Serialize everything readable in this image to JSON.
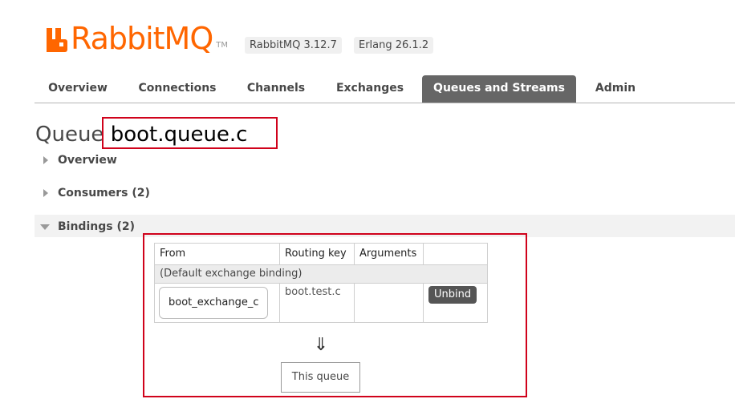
{
  "brand": {
    "name": "RabbitMQ",
    "tm": "TM",
    "color": "#ff6600"
  },
  "versions": [
    "RabbitMQ 3.12.7",
    "Erlang 26.1.2"
  ],
  "tabs": [
    {
      "label": "Overview",
      "active": false
    },
    {
      "label": "Connections",
      "active": false
    },
    {
      "label": "Channels",
      "active": false
    },
    {
      "label": "Exchanges",
      "active": false
    },
    {
      "label": "Queues and Streams",
      "active": true
    },
    {
      "label": "Admin",
      "active": false
    }
  ],
  "page": {
    "title_prefix": "Queue",
    "queue_name": "boot.queue.c"
  },
  "sections": {
    "overview": "Overview",
    "consumers": "Consumers (2)",
    "bindings": "Bindings (2)"
  },
  "bindings_table": {
    "headers": [
      "From",
      "Routing key",
      "Arguments",
      ""
    ],
    "default_row": "(Default exchange binding)",
    "rows": [
      {
        "from": "boot_exchange_c",
        "routing_key": "boot.test.c",
        "arguments": "",
        "action": "Unbind"
      }
    ],
    "arrow": "⇓",
    "this_queue": "This queue"
  },
  "colors": {
    "accent_red_outline": "#d0021b",
    "tab_active_bg": "#666666"
  }
}
